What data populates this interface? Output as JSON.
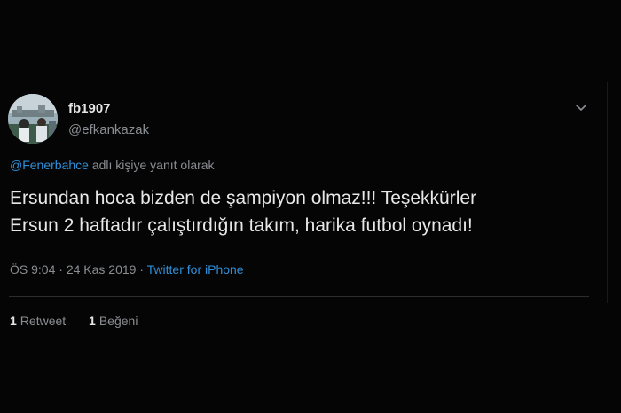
{
  "colors": {
    "background": "#050505",
    "text": "#e8e8e8",
    "secondary": "#8a8d91",
    "link": "#2f8fd8",
    "divider": "#2b2d30"
  },
  "user": {
    "display_name": "fb1907",
    "handle": "@efkankazak",
    "avatar_icon": "avatar-photo"
  },
  "reply": {
    "mention": "@Fenerbahce",
    "suffix": "adlı kişiye yanıt olarak"
  },
  "tweet": {
    "line1": "Ersundan hoca bizden de şampiyon olmaz!!! Teşekkürler",
    "line2": "Ersun 2 haftadır çalıştırdığın takım, harika futbol oynadı!"
  },
  "meta": {
    "time": "ÖS 9:04",
    "separator1": "·",
    "date": "24 Kas 2019",
    "separator2": "·",
    "source": "Twitter for iPhone"
  },
  "stats": {
    "retweets_count": "1",
    "retweets_label": "Retweet",
    "likes_count": "1",
    "likes_label": "Beğeni"
  },
  "icons": {
    "menu": "chevron-down-icon"
  }
}
